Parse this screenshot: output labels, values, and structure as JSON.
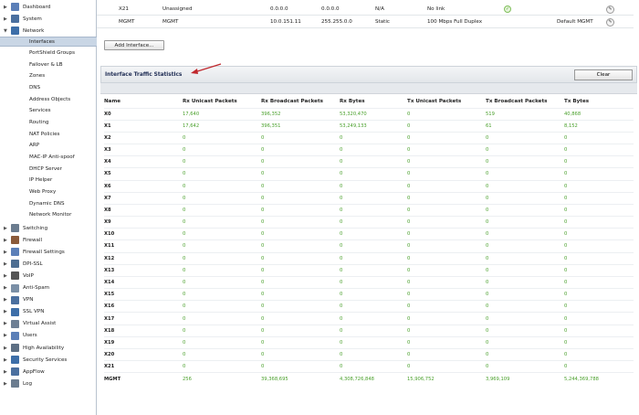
{
  "sidebar": {
    "items": [
      {
        "label": "Dashboard",
        "icon": "dashboard-icon",
        "expanded": false,
        "color": "#5b7fb8"
      },
      {
        "label": "System",
        "icon": "system-icon",
        "expanded": false,
        "color": "#4a6f9f"
      },
      {
        "label": "Network",
        "icon": "network-icon",
        "expanded": true,
        "color": "#3d6ea8"
      }
    ],
    "network_subitems": [
      "Interfaces",
      "PortShield Groups",
      "Failover & LB",
      "Zones",
      "DNS",
      "Address Objects",
      "Services",
      "Routing",
      "NAT Policies",
      "ARP",
      "MAC-IP Anti-spoof",
      "DHCP Server",
      "IP Helper",
      "Web Proxy",
      "Dynamic DNS",
      "Network Monitor"
    ],
    "active_subitem": "Interfaces",
    "bottom_items": [
      {
        "label": "Switching",
        "icon": "switching-icon",
        "color": "#6b7c8f"
      },
      {
        "label": "Firewall",
        "icon": "firewall-icon",
        "color": "#8a5a3a"
      },
      {
        "label": "Firewall Settings",
        "icon": "firewall-settings-icon",
        "color": "#5b7fb8"
      },
      {
        "label": "DPI-SSL",
        "icon": "dpi-ssl-icon",
        "color": "#4d6d91"
      },
      {
        "label": "VoIP",
        "icon": "voip-icon",
        "color": "#555555"
      },
      {
        "label": "Anti-Spam",
        "icon": "anti-spam-icon",
        "color": "#7a8fa6"
      },
      {
        "label": "VPN",
        "icon": "vpn-icon",
        "color": "#4a6f9f"
      },
      {
        "label": "SSL VPN",
        "icon": "ssl-vpn-icon",
        "color": "#3d6ea8"
      },
      {
        "label": "Virtual Assist",
        "icon": "virtual-assist-icon",
        "color": "#6d7f94"
      },
      {
        "label": "Users",
        "icon": "users-icon",
        "color": "#5b7fb8"
      },
      {
        "label": "High Availability",
        "icon": "high-availability-icon",
        "color": "#5d6f84"
      },
      {
        "label": "Security Services",
        "icon": "security-services-icon",
        "color": "#3d6ea8"
      },
      {
        "label": "AppFlow",
        "icon": "appflow-icon",
        "color": "#4a6f9f"
      },
      {
        "label": "Log",
        "icon": "log-icon",
        "color": "#6b7c8f"
      }
    ]
  },
  "top_rows": [
    {
      "name": "X21",
      "zone": "Unassigned",
      "ip": "0.0.0.0",
      "subnet": "0.0.0.0",
      "mode": "N/A",
      "link": "No link",
      "comment": "",
      "has_status_ok": true
    },
    {
      "name": "MGMT",
      "zone": "MGMT",
      "ip": "10.0.151.11",
      "subnet": "255.255.0.0",
      "mode": "Static",
      "link": "100 Mbps Full Duplex",
      "comment": "Default MGMT",
      "has_status_ok": false
    }
  ],
  "add_interface_label": "Add Interface...",
  "stats": {
    "title": "Interface Traffic Statistics",
    "clear_label": "Clear",
    "headers": [
      "Name",
      "Rx Unicast Packets",
      "Rx Broadcast Packets",
      "Rx Bytes",
      "Tx Unicast Packets",
      "Tx Broadcast Packets",
      "Tx Bytes"
    ],
    "rows": [
      [
        "X0",
        "17,640",
        "396,352",
        "53,320,470",
        "0",
        "519",
        "40,868"
      ],
      [
        "X1",
        "17,642",
        "396,351",
        "53,249,133",
        "0",
        "61",
        "8,152"
      ],
      [
        "X2",
        "0",
        "0",
        "0",
        "0",
        "0",
        "0"
      ],
      [
        "X3",
        "0",
        "0",
        "0",
        "0",
        "0",
        "0"
      ],
      [
        "X4",
        "0",
        "0",
        "0",
        "0",
        "0",
        "0"
      ],
      [
        "X5",
        "0",
        "0",
        "0",
        "0",
        "0",
        "0"
      ],
      [
        "X6",
        "0",
        "0",
        "0",
        "0",
        "0",
        "0"
      ],
      [
        "X7",
        "0",
        "0",
        "0",
        "0",
        "0",
        "0"
      ],
      [
        "X8",
        "0",
        "0",
        "0",
        "0",
        "0",
        "0"
      ],
      [
        "X9",
        "0",
        "0",
        "0",
        "0",
        "0",
        "0"
      ],
      [
        "X10",
        "0",
        "0",
        "0",
        "0",
        "0",
        "0"
      ],
      [
        "X11",
        "0",
        "0",
        "0",
        "0",
        "0",
        "0"
      ],
      [
        "X12",
        "0",
        "0",
        "0",
        "0",
        "0",
        "0"
      ],
      [
        "X13",
        "0",
        "0",
        "0",
        "0",
        "0",
        "0"
      ],
      [
        "X14",
        "0",
        "0",
        "0",
        "0",
        "0",
        "0"
      ],
      [
        "X15",
        "0",
        "0",
        "0",
        "0",
        "0",
        "0"
      ],
      [
        "X16",
        "0",
        "0",
        "0",
        "0",
        "0",
        "0"
      ],
      [
        "X17",
        "0",
        "0",
        "0",
        "0",
        "0",
        "0"
      ],
      [
        "X18",
        "0",
        "0",
        "0",
        "0",
        "0",
        "0"
      ],
      [
        "X19",
        "0",
        "0",
        "0",
        "0",
        "0",
        "0"
      ],
      [
        "X20",
        "0",
        "0",
        "0",
        "0",
        "0",
        "0"
      ],
      [
        "X21",
        "0",
        "0",
        "0",
        "0",
        "0",
        "0"
      ],
      [
        "MGMT",
        "256",
        "39,368,695",
        "4,308,726,848",
        "15,906,752",
        "3,969,109",
        "5,244,369,788"
      ]
    ]
  },
  "colors": {
    "value_green": "#4aa02c",
    "active_bg": "#c9d6e5",
    "title_navy": "#1f2d54",
    "annotation_arrow": "#c0282d"
  }
}
